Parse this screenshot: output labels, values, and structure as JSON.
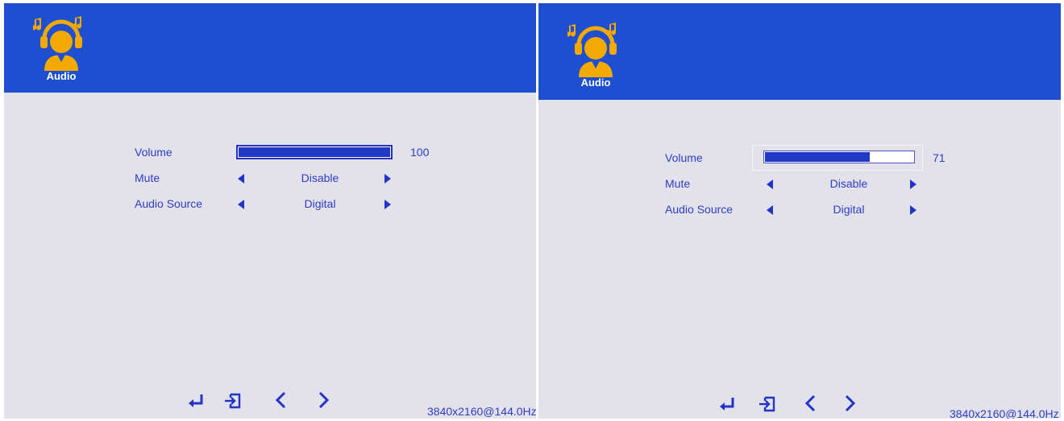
{
  "screens": [
    {
      "header": {
        "icon": "headphones-person-icon",
        "title": "Audio",
        "color": "#1e4fd0"
      },
      "volume": {
        "label": "Volume",
        "value": "100",
        "fraction": 1.0
      },
      "mute": {
        "label": "Mute",
        "value": "Disable"
      },
      "audio_source": {
        "label": "Audio Source",
        "value": "Digital"
      },
      "footer": {
        "icons": [
          "enter-icon",
          "exit-icon",
          "chevron-left-icon",
          "chevron-right-icon"
        ],
        "resolution": "3840x2160@144.0Hz"
      }
    },
    {
      "header": {
        "icon": "headphones-person-icon",
        "title": "Audio",
        "color": "#1e4fd0"
      },
      "volume": {
        "label": "Volume",
        "value": "71",
        "fraction": 0.71,
        "selected": true
      },
      "mute": {
        "label": "Mute",
        "value": "Disable"
      },
      "audio_source": {
        "label": "Audio Source",
        "value": "Digital"
      },
      "footer": {
        "icons": [
          "enter-icon",
          "exit-icon",
          "chevron-left-icon",
          "chevron-right-icon"
        ],
        "resolution": "3840x2160@144.0Hz"
      }
    }
  ],
  "colors": {
    "header": "#1e4fd0",
    "background": "#e3e2ea",
    "text": "#2f3cc4",
    "bar": "#2139c4",
    "icon": "#f2a900"
  }
}
